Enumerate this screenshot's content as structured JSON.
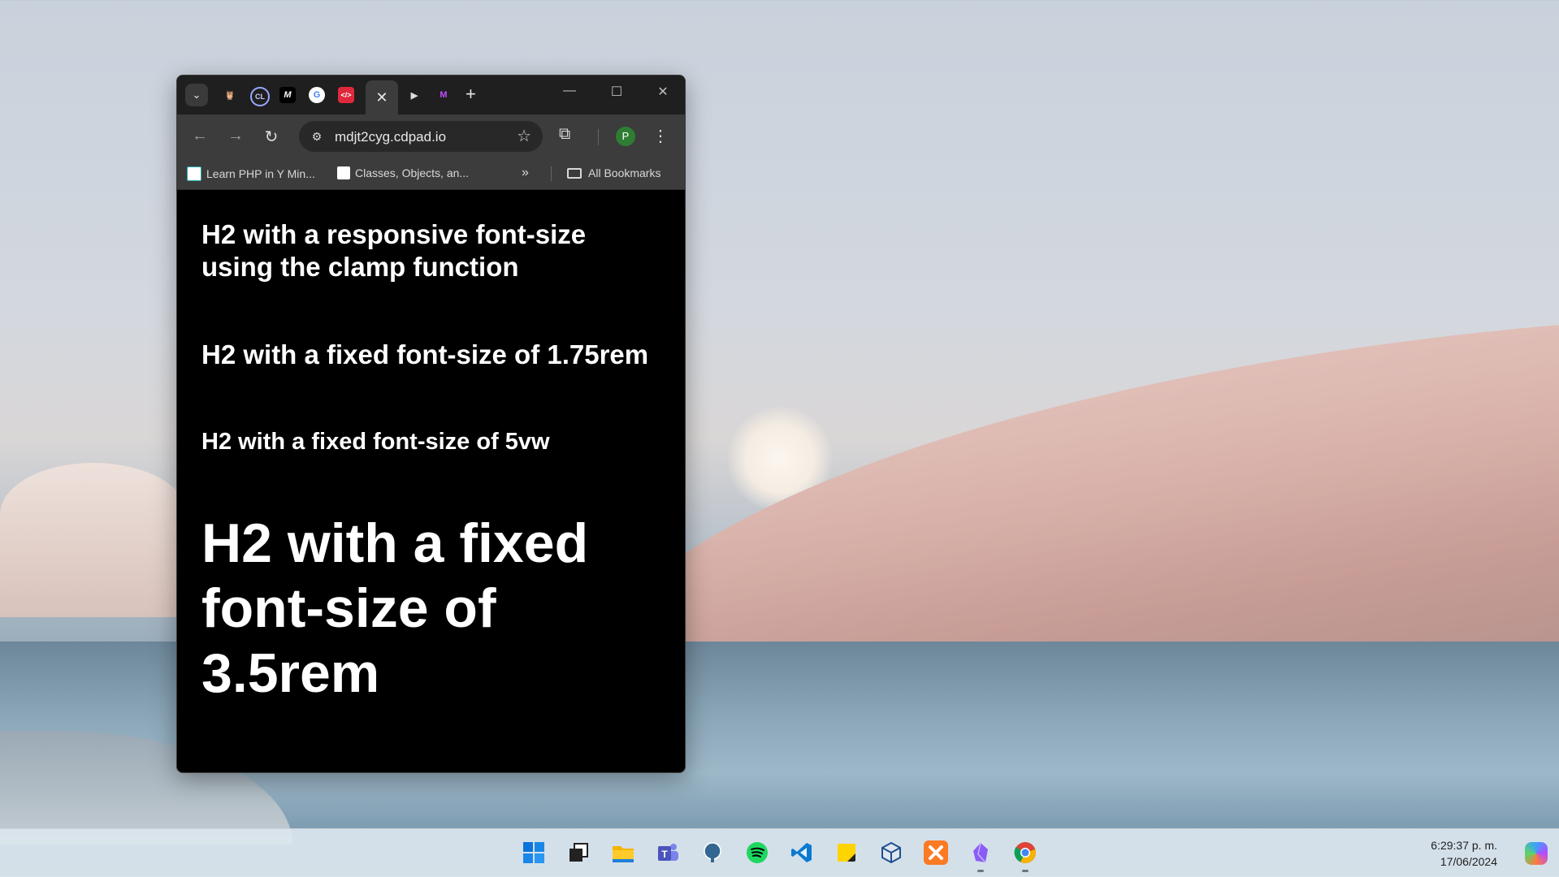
{
  "browser": {
    "tabs": [
      {
        "icon": "tab-list-dropdown-icon",
        "glyph": "⌄"
      },
      {
        "icon": "favicon-bear-icon",
        "glyph": "🦉"
      },
      {
        "icon": "favicon-cl-icon",
        "glyph": "CL"
      },
      {
        "icon": "favicon-m-icon",
        "glyph": "M"
      },
      {
        "icon": "favicon-google-icon",
        "glyph": "G"
      },
      {
        "icon": "favicon-code-icon",
        "glyph": "</>"
      },
      {
        "icon": "favicon-play-icon",
        "glyph": "▶"
      },
      {
        "icon": "favicon-m-purple-icon",
        "glyph": "M"
      }
    ],
    "active_tab_close": "✕",
    "new_tab": "+",
    "address": "mdjt2cyg.cdpad.io",
    "profile_initial": "P",
    "bookmarks": [
      {
        "label": "Learn PHP in Y Min..."
      },
      {
        "label": "Classes, Objects, an..."
      }
    ],
    "all_bookmarks": "All Bookmarks",
    "colors": {
      "profile": "#2e7d32",
      "tabbar": "#1f1f1f",
      "toolbar": "#3c3c3c"
    }
  },
  "page": {
    "h2_clamp": "H2 with a responsive font-size using the clamp function",
    "h2_175rem": "H2 with a fixed font-size of 1.75rem",
    "h2_5vw": "H2 with a fixed font-size of 5vw",
    "h2_35rem": "H2 with a fixed font-size of 3.5rem"
  },
  "taskbar": {
    "apps": [
      {
        "name": "start-icon"
      },
      {
        "name": "task-view-icon"
      },
      {
        "name": "file-explorer-icon"
      },
      {
        "name": "teams-icon"
      },
      {
        "name": "postgresql-icon"
      },
      {
        "name": "spotify-icon"
      },
      {
        "name": "vscode-icon"
      },
      {
        "name": "sticky-notes-icon"
      },
      {
        "name": "virtualbox-icon"
      },
      {
        "name": "xampp-icon"
      },
      {
        "name": "obsidian-icon"
      },
      {
        "name": "chrome-icon"
      }
    ],
    "time": "6:29:37 p. m.",
    "date": "17/06/2024"
  }
}
